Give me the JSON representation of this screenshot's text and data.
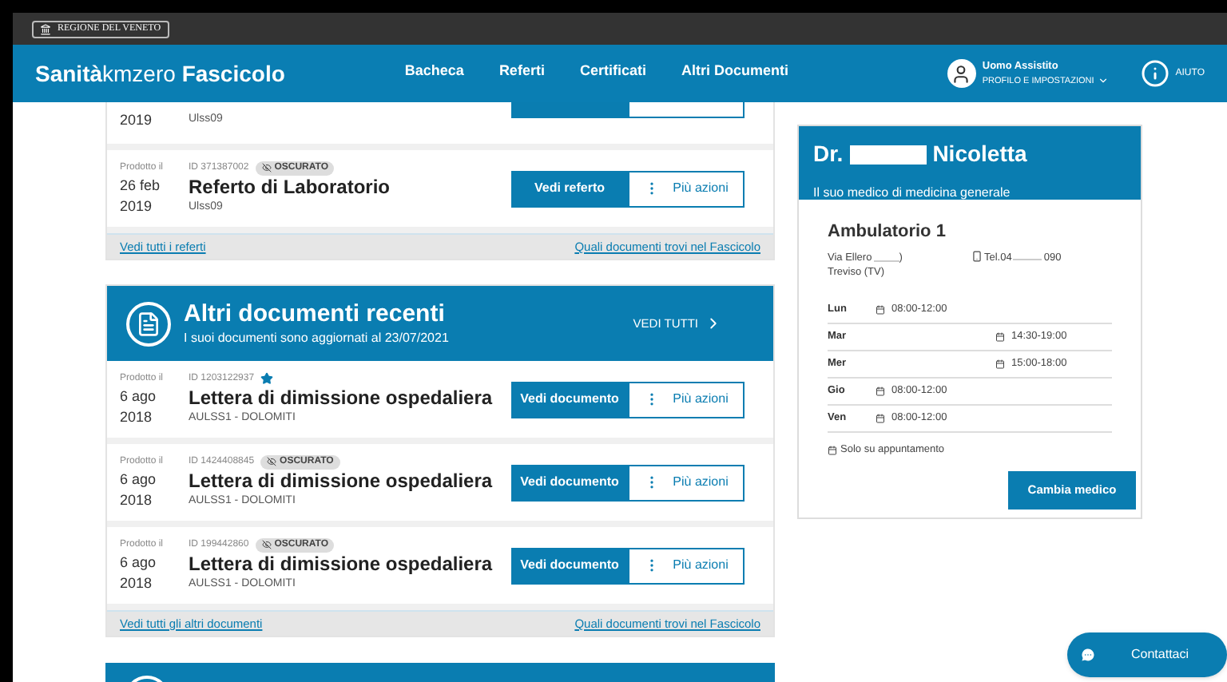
{
  "top_bar": {
    "region_label": "REGIONE DEL VENETO"
  },
  "header": {
    "brand": "**Sanità**kmzero **Fascicolo**",
    "nav": [
      {
        "label": "Bacheca",
        "selected": false
      },
      {
        "label": "Referti",
        "selected": false
      },
      {
        "label": "Certificati",
        "selected": false
      },
      {
        "label": "Altri Documenti",
        "selected": false
      }
    ],
    "user": {
      "name": "Uomo Assistito",
      "menu": "PROFILO E IMPOSTAZIONI"
    },
    "help": "AIUTO"
  },
  "referti": {
    "rows": [
      {
        "kind": "partial",
        "year": "2019",
        "issuer": "Ulss09"
      },
      {
        "kind": "full",
        "produced_label": "Prodotto il",
        "day": "26 feb",
        "year": "2019",
        "id": "ID 371387002",
        "starred": false,
        "badge": "OSCURATO",
        "title": "Referto di Laboratorio",
        "issuer": "Ulss09",
        "primary": "Vedi referto",
        "more": "Più azioni"
      }
    ],
    "footer_left": "Vedi tutti i referti",
    "footer_right": "Quali documenti trovi nel Fascicolo"
  },
  "altri": {
    "title": "Altri documenti recenti",
    "subtitle": "I suoi documenti sono aggiornati al 23/07/2021",
    "see_all": "VEDI TUTTI",
    "rows": [
      {
        "kind": "full",
        "produced_label": "Prodotto il",
        "day": "6 ago",
        "year": "2018",
        "id": "ID 1203122937",
        "starred": true,
        "title": "Lettera di dimissione ospedaliera",
        "issuer": "AULSS1 - DOLOMITI",
        "primary": "Vedi documento",
        "more": "Più azioni"
      },
      {
        "kind": "full",
        "produced_label": "Prodotto il",
        "day": "6 ago",
        "year": "2018",
        "id": "ID 1424408845",
        "starred": false,
        "badge": "OSCURATO",
        "title": "Lettera di dimissione ospedaliera",
        "issuer": "AULSS1 - DOLOMITI",
        "primary": "Vedi documento",
        "more": "Più azioni"
      },
      {
        "kind": "full",
        "produced_label": "Prodotto il",
        "day": "6 ago",
        "year": "2018",
        "id": "ID 199442860",
        "starred": false,
        "badge": "OSCURATO",
        "title": "Lettera di dimissione ospedaliera",
        "issuer": "AULSS1 - DOLOMITI",
        "primary": "Vedi documento",
        "more": "Più azioni"
      }
    ],
    "footer_left": "Vedi tutti gli altri documenti",
    "footer_right": "Quali documenti trovi nel Fascicolo"
  },
  "doctor": {
    "title_prefix": "Dr.",
    "title_suffix": "Nicoletta",
    "subtitle": "Il suo medico di medicina generale",
    "office": "Ambulatorio 1",
    "address_prefix": "Via Ellero",
    "address_suffix": ")",
    "city": "Treviso (TV)",
    "phone_prefix": "Tel.04",
    "phone_suffix": "090",
    "schedule": [
      {
        "day": "Lun",
        "kind": "morning",
        "hours": "08:00-12:00"
      },
      {
        "day": "Mar",
        "kind": "afternoon",
        "hours": "14:30-19:00"
      },
      {
        "day": "Mer",
        "kind": "afternoon",
        "hours": "15:00-18:00"
      },
      {
        "day": "Gio",
        "kind": "morning",
        "hours": "08:00-12:00"
      },
      {
        "day": "Ven",
        "kind": "morning",
        "hours": "08:00-12:00"
      }
    ],
    "note": "Solo su appuntamento",
    "button": "Cambia medico"
  },
  "contact_button": "Contattaci"
}
